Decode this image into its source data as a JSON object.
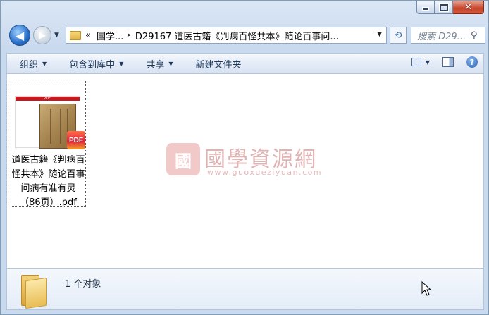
{
  "window": {
    "caption": {
      "minimize": "minimize-icon",
      "maximize": "maximize-icon",
      "close": "close-icon"
    }
  },
  "nav": {
    "back_icon": "back-arrow-icon",
    "forward_icon": "forward-arrow-icon",
    "address": {
      "overflow": "«",
      "crumb1": "国学...",
      "sep": "▸",
      "crumb2": "D29167 道医古籍《判病百怪共本》随论百事问..."
    },
    "search_placeholder": "搜索 D29..."
  },
  "toolbar": {
    "organize": "组织",
    "include_library": "包含到库中",
    "share": "共享",
    "new_folder": "新建文件夹"
  },
  "content": {
    "files": [
      {
        "name": "道医古籍《判病百怪共本》随论百事问病有准有灵（86页）.pdf",
        "thumb_header": "PDF",
        "badge": "PDF",
        "icon": "pdf-file-icon"
      }
    ],
    "watermark": {
      "seal": "國",
      "title": "國學資源網",
      "url": "www.guoxueziyuan.com"
    }
  },
  "details": {
    "count": "1 个对象",
    "icon": "folder-icon"
  },
  "colors": {
    "accent": "#2a6fc9",
    "pdf_red": "#c8171e",
    "watermark": "#e2b3b3"
  }
}
